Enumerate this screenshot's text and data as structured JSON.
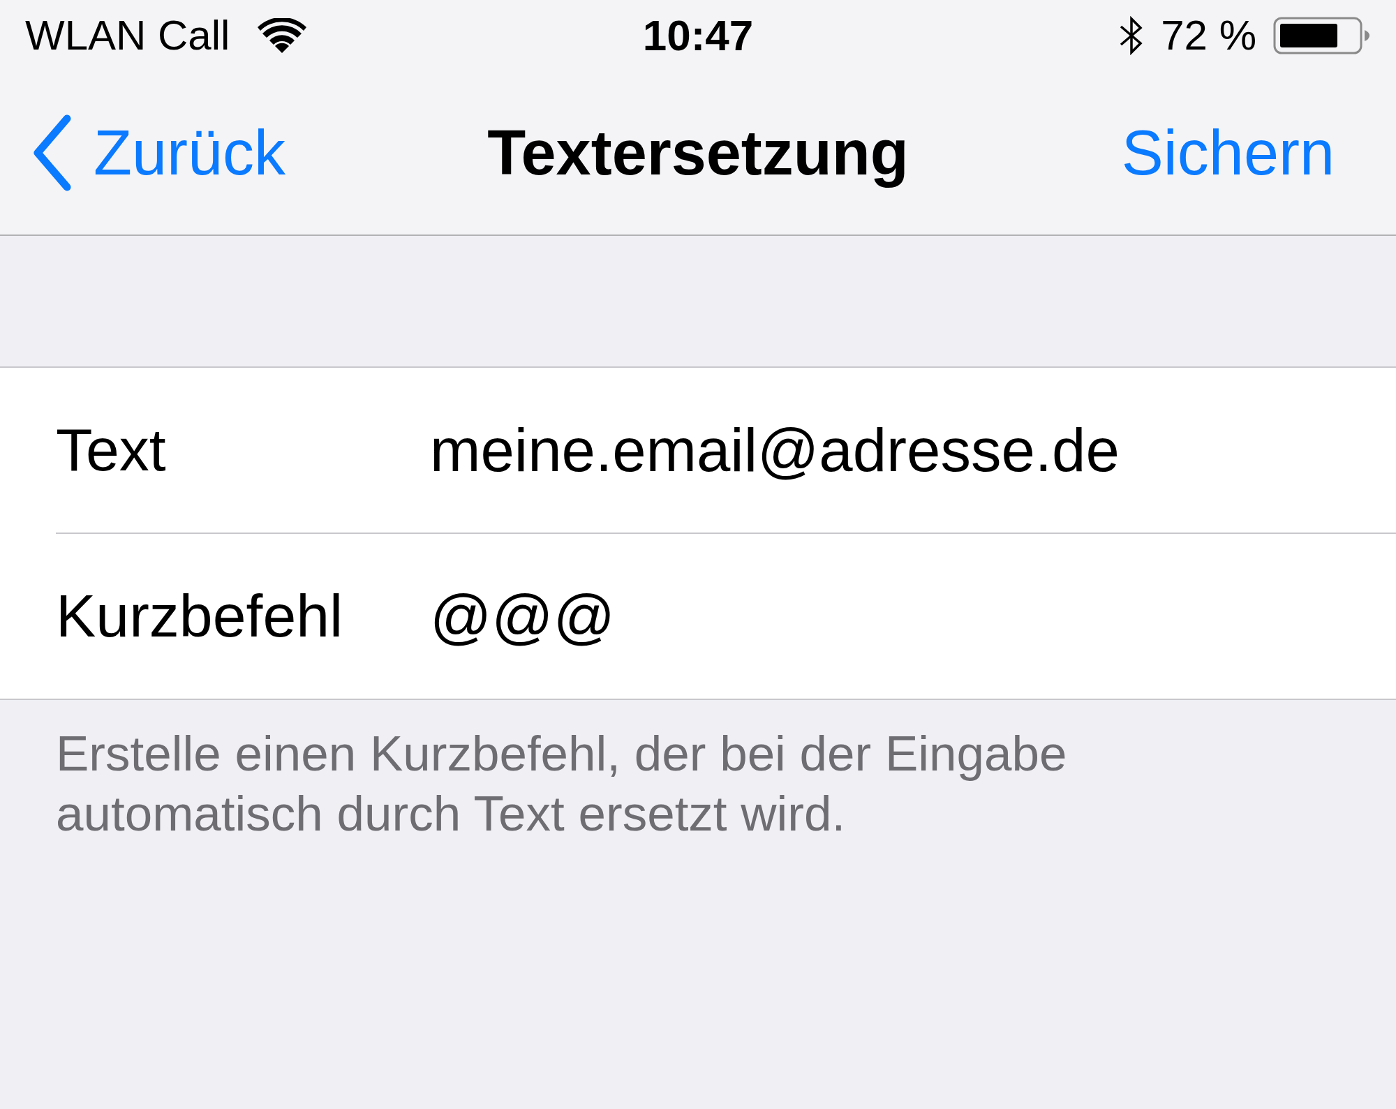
{
  "status_bar": {
    "carrier": "WLAN Call",
    "time": "10:47",
    "battery": "72 %"
  },
  "nav_bar": {
    "back": "Zurück",
    "title": "Textersetzung",
    "action": "Sichern"
  },
  "form": {
    "rows": [
      {
        "label": "Text",
        "value": "meine.email@adresse.de"
      },
      {
        "label": "Kurzbefehl",
        "value": "@@@"
      }
    ]
  },
  "footer": "Erstelle einen Kurzbefehl, der bei der Eingabe automatisch durch Text ersetzt wird."
}
